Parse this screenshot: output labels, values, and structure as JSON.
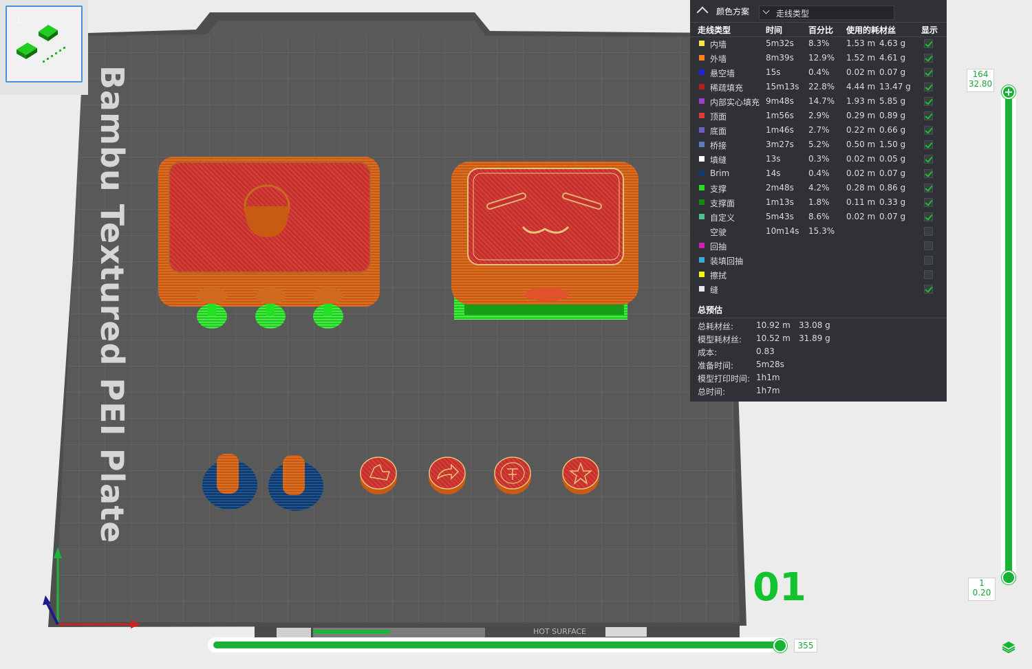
{
  "plate": {
    "label": "Bambu Textured PEI Plate",
    "number": "01",
    "hot_surface": "HOT SURFACE"
  },
  "thumbnail": {
    "index": "1"
  },
  "legend": {
    "title": "颜色方案",
    "view_type": "走线类型",
    "headers": {
      "type": "走线类型",
      "time": "时间",
      "percent": "百分比",
      "filament": "使用的耗材丝",
      "display": "显示"
    },
    "rows": [
      {
        "name": "内墙",
        "time": "5m32s",
        "percent": "8.3%",
        "length": "1.53 m",
        "weight": "4.63 g",
        "color": "#f7e44a",
        "shown": true
      },
      {
        "name": "外墙",
        "time": "8m39s",
        "percent": "12.9%",
        "length": "1.52 m",
        "weight": "4.61 g",
        "color": "#f5821f",
        "shown": true
      },
      {
        "name": "悬空墙",
        "time": "15s",
        "percent": "0.4%",
        "length": "0.02 m",
        "weight": "0.07 g",
        "color": "#2222dd",
        "shown": true
      },
      {
        "name": "稀疏填充",
        "time": "15m13s",
        "percent": "22.8%",
        "length": "4.44 m",
        "weight": "13.47 g",
        "color": "#b22222",
        "shown": true
      },
      {
        "name": "内部实心填充",
        "time": "9m48s",
        "percent": "14.7%",
        "length": "1.93 m",
        "weight": "5.85 g",
        "color": "#9b3fc9",
        "shown": true
      },
      {
        "name": "顶面",
        "time": "1m56s",
        "percent": "2.9%",
        "length": "0.29 m",
        "weight": "0.89 g",
        "color": "#e03c3c",
        "shown": true
      },
      {
        "name": "底面",
        "time": "1m46s",
        "percent": "2.7%",
        "length": "0.22 m",
        "weight": "0.66 g",
        "color": "#6b5fc4",
        "shown": true
      },
      {
        "name": "桥接",
        "time": "3m27s",
        "percent": "5.2%",
        "length": "0.50 m",
        "weight": "1.50 g",
        "color": "#5a7fb8",
        "shown": true
      },
      {
        "name": "填缝",
        "time": "13s",
        "percent": "0.3%",
        "length": "0.02 m",
        "weight": "0.05 g",
        "color": "#ffffff",
        "shown": true
      },
      {
        "name": "Brim",
        "time": "14s",
        "percent": "0.4%",
        "length": "0.02 m",
        "weight": "0.07 g",
        "color": "#0f3d6e",
        "shown": true
      },
      {
        "name": "支撑",
        "time": "2m48s",
        "percent": "4.2%",
        "length": "0.28 m",
        "weight": "0.86 g",
        "color": "#22dd22",
        "shown": true
      },
      {
        "name": "支撑面",
        "time": "1m13s",
        "percent": "1.8%",
        "length": "0.11 m",
        "weight": "0.33 g",
        "color": "#118811",
        "shown": true
      },
      {
        "name": "自定义",
        "time": "5m43s",
        "percent": "8.6%",
        "length": "0.02 m",
        "weight": "0.07 g",
        "color": "#4fbf8f",
        "shown": true
      },
      {
        "name": "空驶",
        "time": "10m14s",
        "percent": "15.3%",
        "length": "",
        "weight": "",
        "color": "",
        "shown": false
      },
      {
        "name": "回抽",
        "time": "",
        "percent": "",
        "length": "",
        "weight": "",
        "color": "#d11fb8",
        "shown": false
      },
      {
        "name": "装填回抽",
        "time": "",
        "percent": "",
        "length": "",
        "weight": "",
        "color": "#3ea8d8",
        "shown": false
      },
      {
        "name": "擦拭",
        "time": "",
        "percent": "",
        "length": "",
        "weight": "",
        "color": "#f5f50a",
        "shown": false
      },
      {
        "name": "缝",
        "time": "",
        "percent": "",
        "length": "",
        "weight": "",
        "color": "#e8e8e8",
        "shown": true
      }
    ],
    "summary": {
      "title": "总预估",
      "rows": [
        {
          "label": "总耗材丝:",
          "v1": "10.92 m",
          "v2": "33.08 g"
        },
        {
          "label": "模型耗材丝:",
          "v1": "10.52 m",
          "v2": "31.89 g"
        },
        {
          "label": "成本:",
          "v1": "0.83",
          "v2": ""
        },
        {
          "label": "准备时间:",
          "v1": "5m28s",
          "v2": ""
        },
        {
          "label": "模型打印时间:",
          "v1": "1h1m",
          "v2": ""
        },
        {
          "label": "总时间:",
          "v1": "1h7m",
          "v2": ""
        }
      ]
    }
  },
  "layer_slider": {
    "top_layer": "164",
    "top_height": "32.80",
    "bottom_layer": "1",
    "bottom_height": "0.20"
  },
  "move_slider": {
    "value": "355"
  },
  "colors": {
    "accent": "#16b335",
    "panel": "#2f3136",
    "plate": "#555555"
  }
}
